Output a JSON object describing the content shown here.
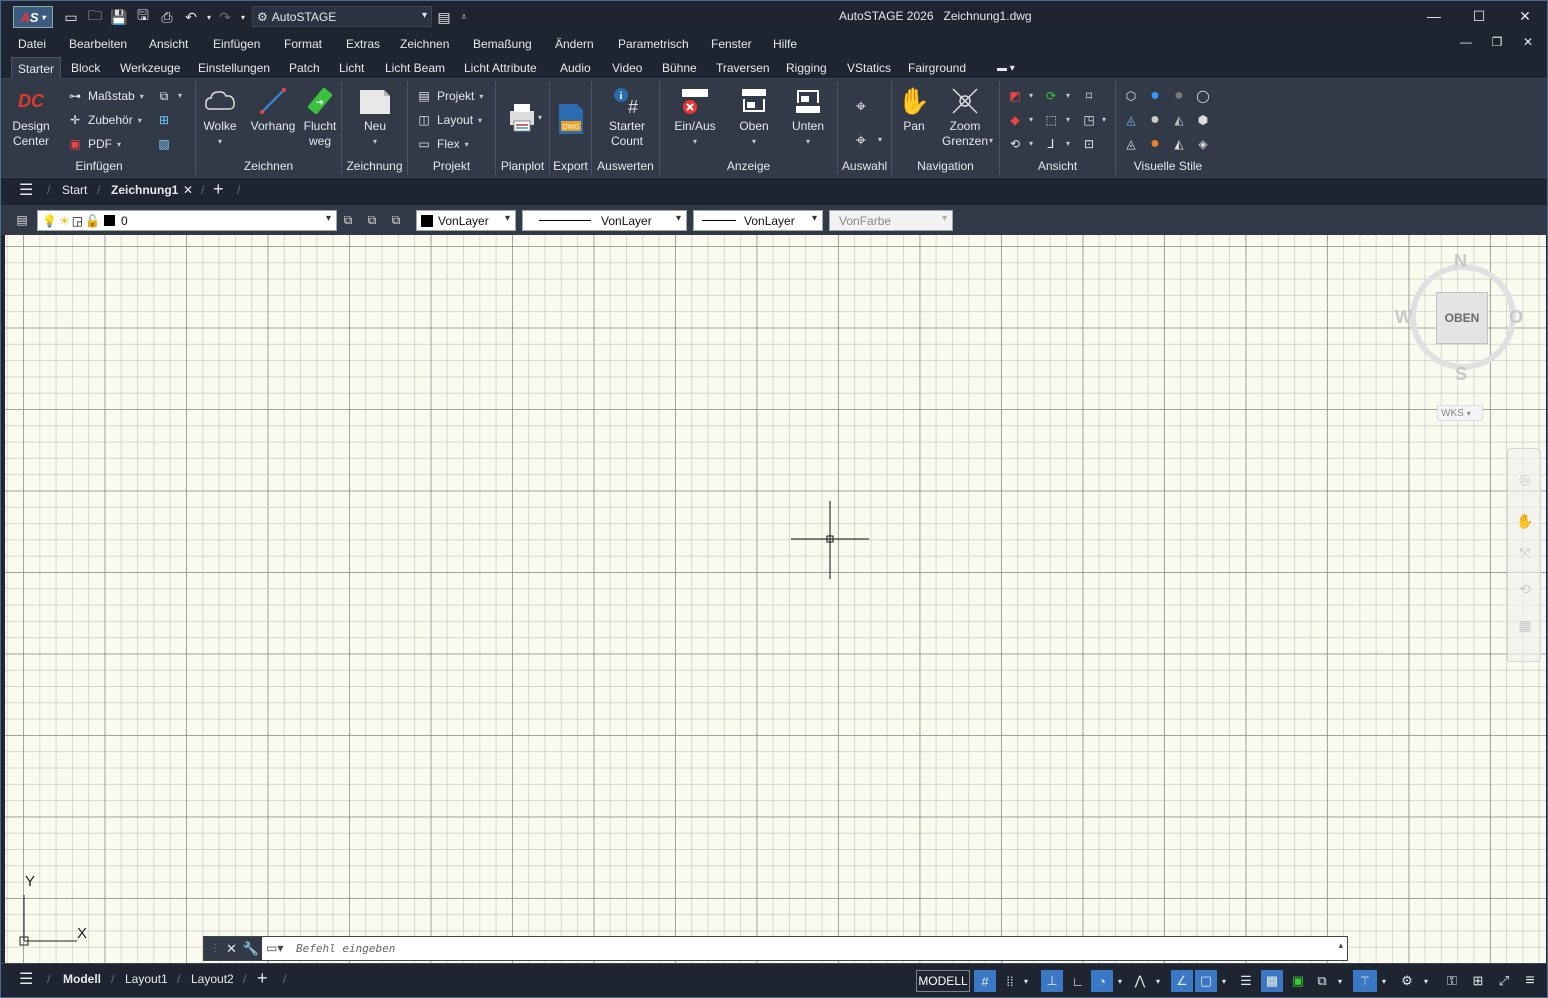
{
  "app": {
    "workspace": "AutoSTAGE",
    "title": "AutoSTAGE 2026",
    "filename": "Zeichnung1.dwg"
  },
  "menu": [
    "Datei",
    "Bearbeiten",
    "Ansicht",
    "Einfügen",
    "Format",
    "Extras",
    "Zeichnen",
    "Bemaßung",
    "Ändern",
    "Parametrisch",
    "Fenster",
    "Hilfe"
  ],
  "ribbon_tabs": [
    "Starter",
    "Block",
    "Werkzeuge",
    "Einstellungen",
    "Patch",
    "Licht",
    "Licht Beam",
    "Licht Attribute",
    "Audio",
    "Video",
    "Bühne",
    "Traversen",
    "Rigging",
    "VStatics",
    "Fairground"
  ],
  "ribbon": {
    "einfuegen": {
      "title": "Einfügen",
      "design_center": "Design\nCenter",
      "massstab": "Maßstab",
      "zubehoer": "Zubehör",
      "pdf": "PDF"
    },
    "zeichnen": {
      "title": "Zeichnen",
      "wolke": "Wolke",
      "vorhang": "Vorhang",
      "fluchtweg": "Flucht\nweg"
    },
    "zeichnung": {
      "title": "Zeichnung",
      "neu": "Neu"
    },
    "projekt": {
      "title": "Projekt",
      "projekt": "Projekt",
      "layout": "Layout",
      "flex": "Flex"
    },
    "planplot": {
      "title": "Planplot"
    },
    "export": {
      "title": "Export",
      "dwg_badge": "DWG"
    },
    "auswerten": {
      "title": "Auswerten",
      "starter_count": "Starter\nCount"
    },
    "anzeige": {
      "title": "Anzeige",
      "einaus": "Ein/Aus",
      "oben": "Oben",
      "unten": "Unten"
    },
    "auswahl": {
      "title": "Auswahl"
    },
    "navigation": {
      "title": "Navigation",
      "pan": "Pan",
      "zoom_grenzen": "Zoom\nGrenzen"
    },
    "ansicht": {
      "title": "Ansicht"
    },
    "visuelle_stile": {
      "title": "Visuelle Stile"
    }
  },
  "file_tabs": {
    "start": "Start",
    "active": "Zeichnung1"
  },
  "props": {
    "layer": "0",
    "color": "VonLayer",
    "linetype": "VonLayer",
    "lineweight": "VonLayer",
    "plotstyle": "VonFarbe"
  },
  "viewcube": {
    "n": "N",
    "s": "S",
    "w": "W",
    "o": "O",
    "face": "OBEN",
    "ucs": "WKS"
  },
  "ucs_icon": {
    "x": "X",
    "y": "Y"
  },
  "command": {
    "placeholder": "Befehl eingeben"
  },
  "status": {
    "tabs": [
      "Modell",
      "Layout1",
      "Layout2"
    ],
    "space": "MODELL"
  },
  "colors": {
    "accent": "#3a78c6",
    "canvas": "#fbfaee",
    "chrome": "#1f2530",
    "ribbon": "#323a48"
  }
}
